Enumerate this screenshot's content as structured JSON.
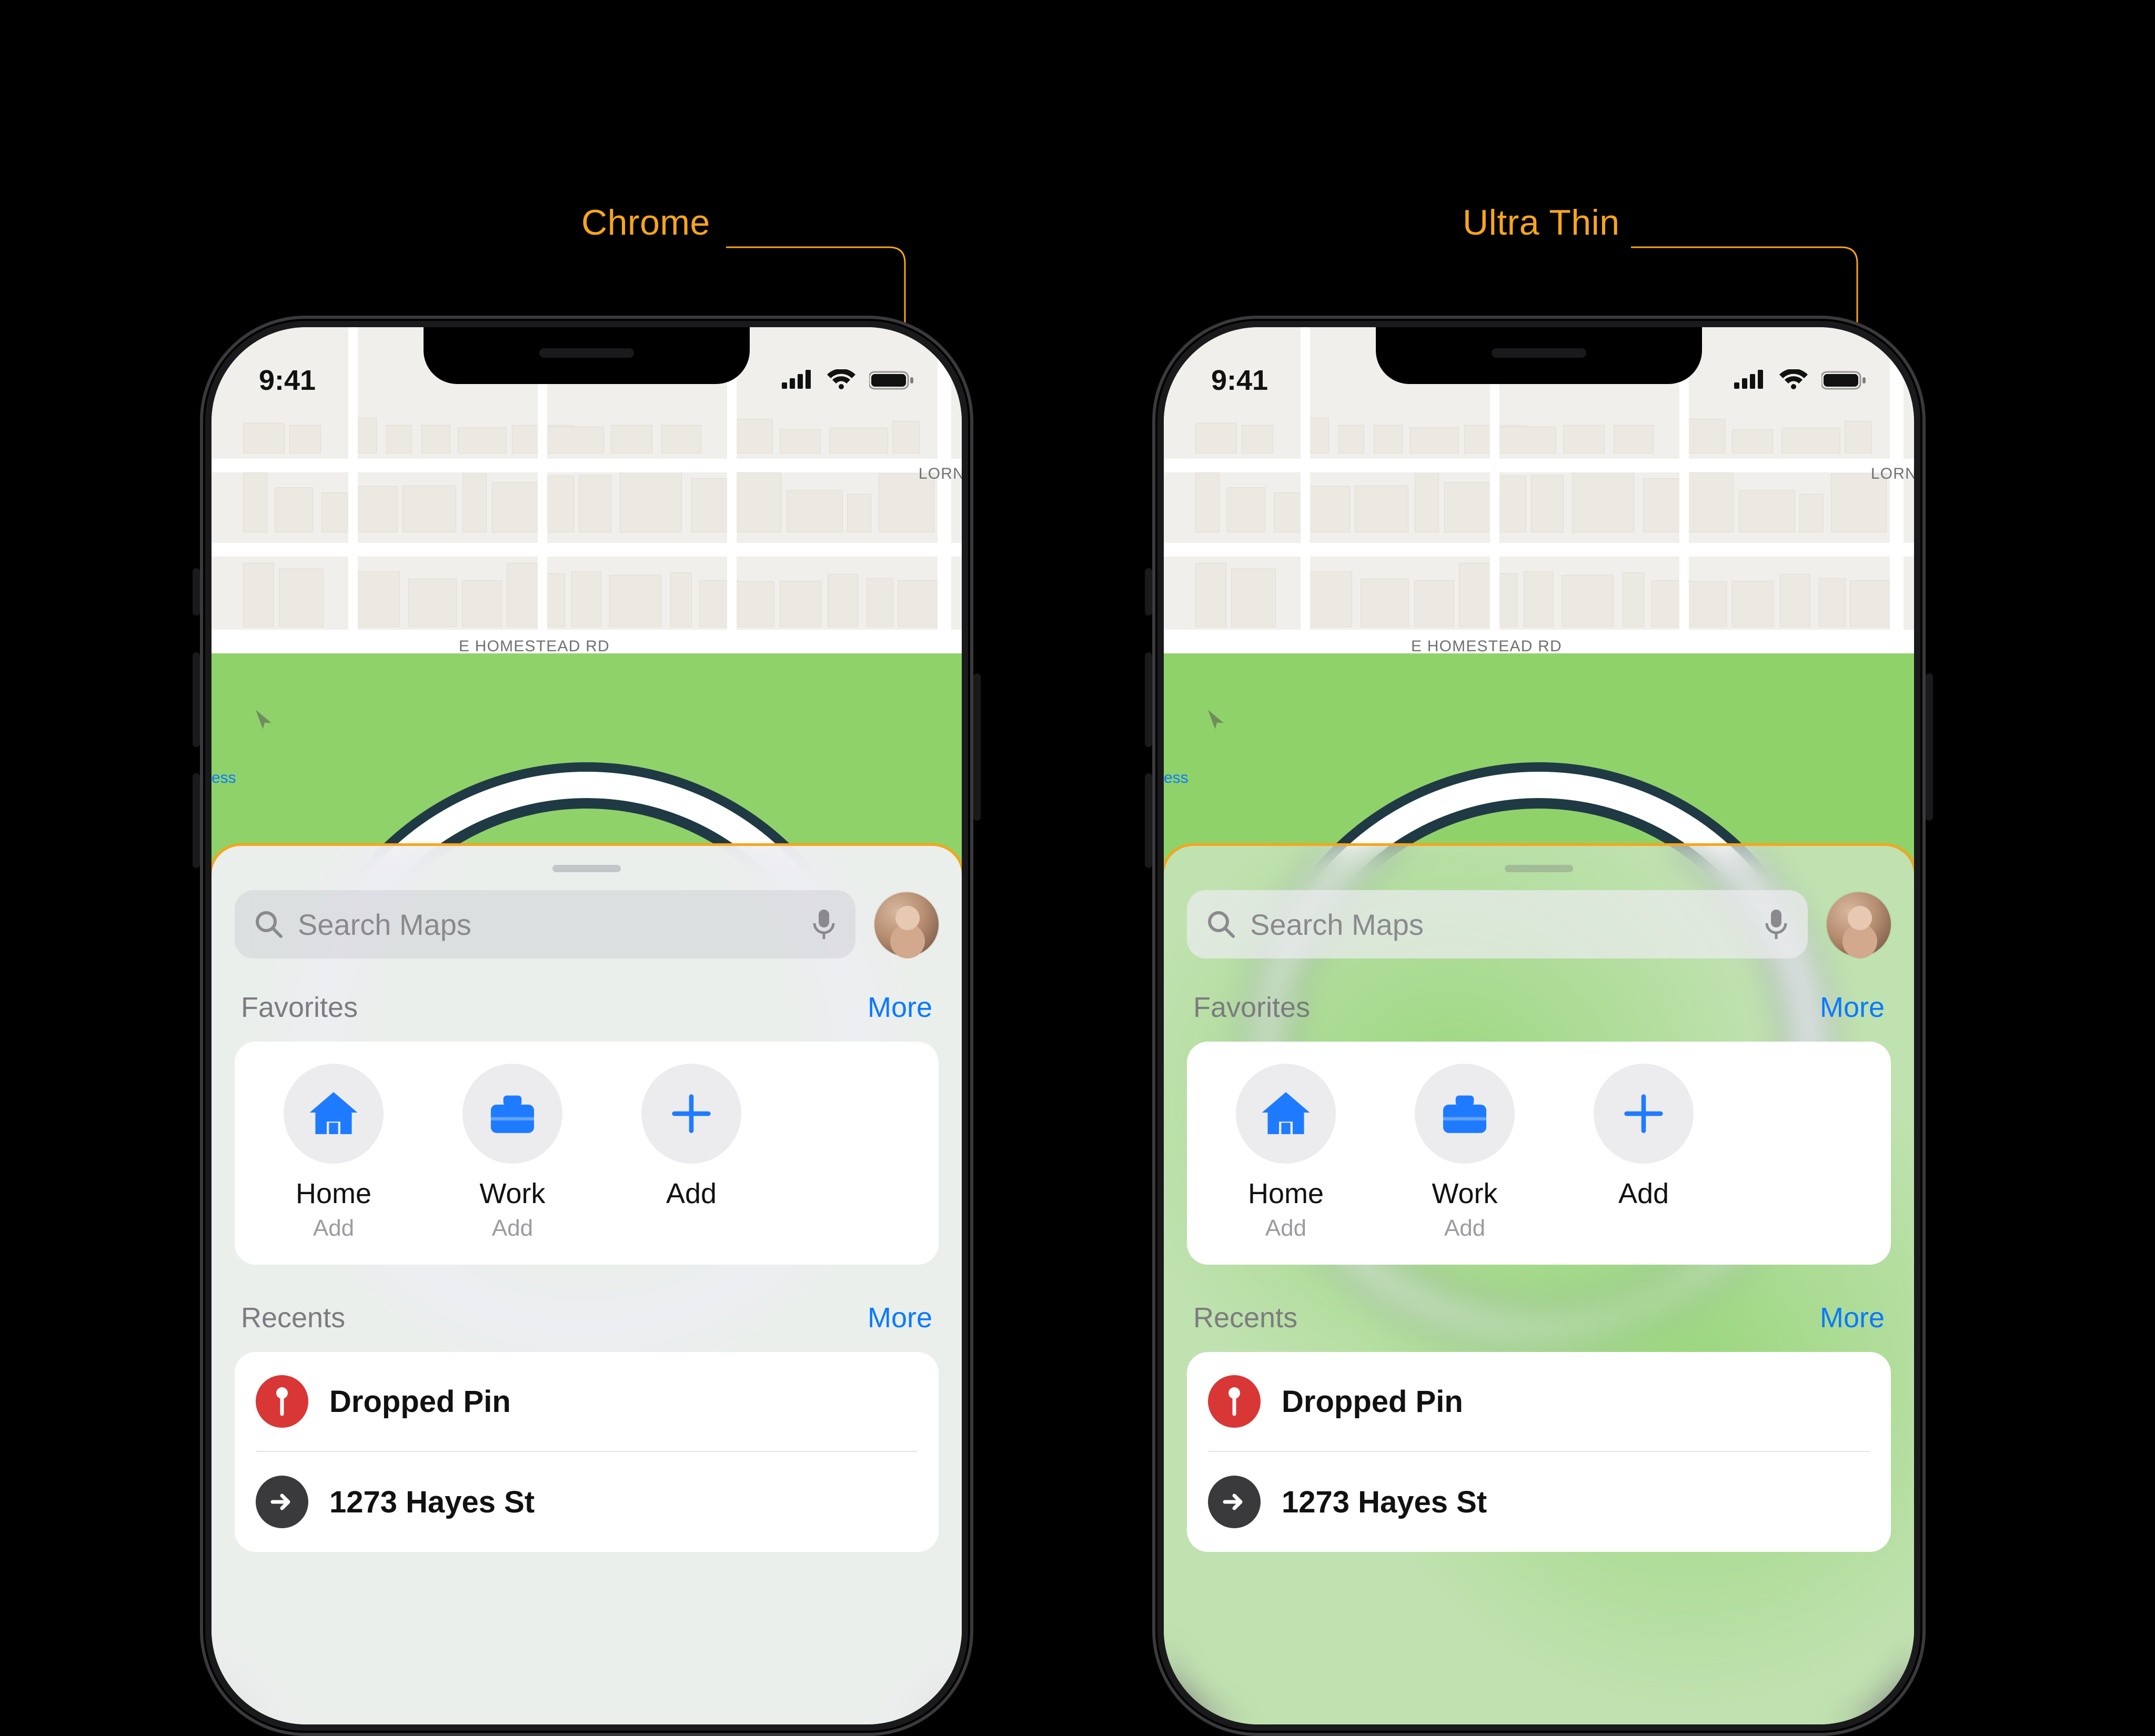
{
  "annotations": {
    "left": "Chrome",
    "right": "Ultra Thin"
  },
  "status": {
    "time": "9:41"
  },
  "map": {
    "street_main": "E HOMESTEAD RD",
    "street_edge": "LORN",
    "link_fragment": "ess"
  },
  "sheet": {
    "search_placeholder": "Search Maps",
    "favorites_title": "Favorites",
    "favorites_more": "More",
    "favorites": [
      {
        "label": "Home",
        "sub": "Add",
        "icon": "house"
      },
      {
        "label": "Work",
        "sub": "Add",
        "icon": "briefcase"
      },
      {
        "label": "Add",
        "sub": "",
        "icon": "plus"
      }
    ],
    "recents_title": "Recents",
    "recents_more": "More",
    "recents": [
      {
        "label": "Dropped Pin",
        "icon": "pin",
        "badge_color": "#d93636"
      },
      {
        "label": "1273 Hayes St",
        "icon": "arrow",
        "badge_color": "#3a3a3c"
      }
    ]
  }
}
